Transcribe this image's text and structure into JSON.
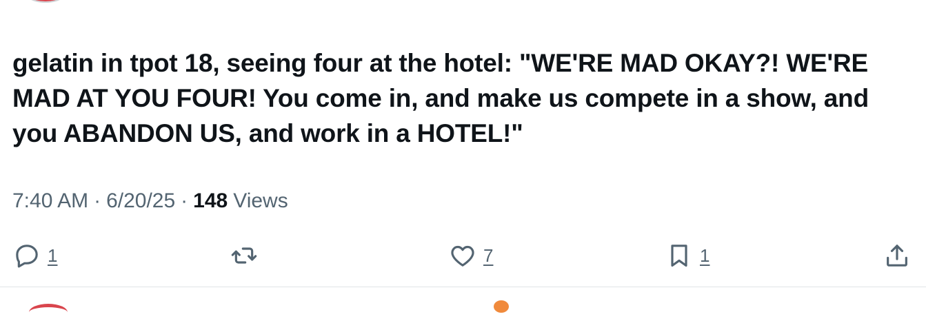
{
  "tweet": {
    "text": "gelatin in tpot 18, seeing four at the hotel: \"WE'RE MAD OKAY?! WE'RE MAD AT YOU FOUR! You come in, and make us compete in a show, and you ABANDON US, and work in a HOTEL!\"",
    "time": "7:40 AM",
    "date": "6/20/25",
    "separator": "·",
    "views_count": "148",
    "views_label": "Views"
  },
  "actions": {
    "reply": {
      "icon": "reply-icon",
      "count": "1"
    },
    "retweet": {
      "icon": "retweet-icon",
      "count": ""
    },
    "like": {
      "icon": "heart-icon",
      "count": "7"
    },
    "bookmark": {
      "icon": "bookmark-icon",
      "count": "1"
    },
    "share": {
      "icon": "share-icon"
    }
  },
  "colors": {
    "text": "#0f1419",
    "secondary": "#536471",
    "divider": "#dfe3e6",
    "background": "#ffffff"
  }
}
